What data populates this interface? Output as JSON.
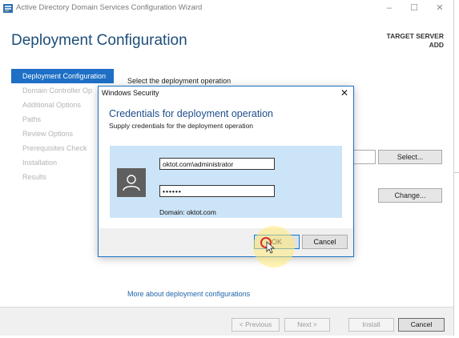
{
  "window": {
    "title": "Active Directory Domain Services Configuration Wizard",
    "controls": {
      "minimize": "–",
      "maximize": "☐",
      "close": "✕"
    }
  },
  "header": {
    "page_title": "Deployment Configuration",
    "target_label": "TARGET SERVER",
    "target_value": "ADD"
  },
  "nav": {
    "items": [
      {
        "label": "Deployment Configuration",
        "active": true
      },
      {
        "label": "Domain Controller Op",
        "active": false
      },
      {
        "label": "Additional Options",
        "active": false
      },
      {
        "label": "Paths",
        "active": false
      },
      {
        "label": "Review Options",
        "active": false
      },
      {
        "label": "Prerequisites Check",
        "active": false
      },
      {
        "label": "Installation",
        "active": false
      },
      {
        "label": "Results",
        "active": false
      }
    ]
  },
  "main": {
    "select_operation_label": "Select the deployment operation",
    "select_button": "Select...",
    "change_button": "Change...",
    "more_link": "More about deployment configurations"
  },
  "footer": {
    "previous": "< Previous",
    "next": "Next >",
    "install": "Install",
    "cancel": "Cancel"
  },
  "dialog": {
    "title": "Windows Security",
    "close": "✕",
    "heading": "Credentials for deployment operation",
    "subtitle": "Supply credentials for the deployment operation",
    "username": "oktot.com\\administrator",
    "password_mask": "••••••",
    "domain_label": "Domain: oktot.com",
    "ok_button": "OK",
    "cancel_button": "Cancel"
  },
  "colors": {
    "accent": "#1e6fc5",
    "heading": "#1e4e79",
    "panel": "#cce4f7",
    "link": "#1f63a8"
  }
}
